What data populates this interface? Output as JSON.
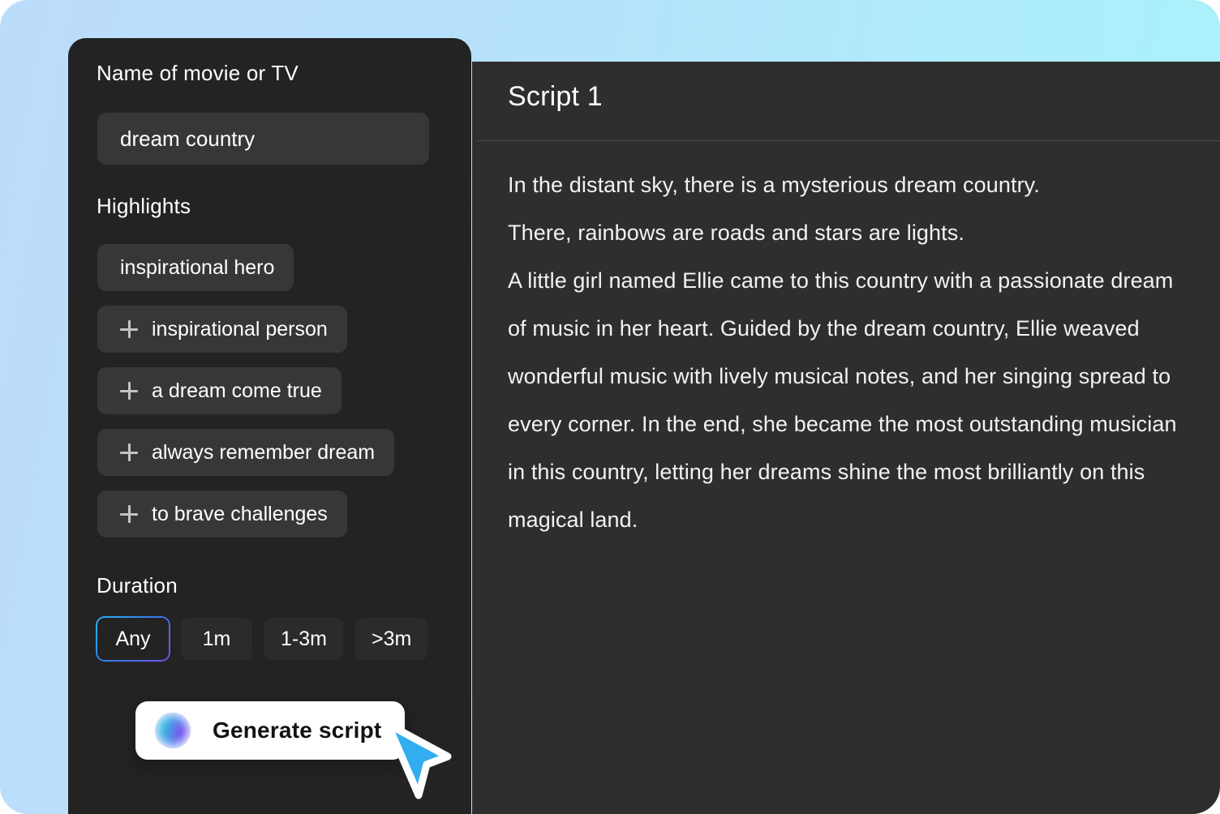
{
  "theme": {
    "bg_gradient_from": "#bcdcfb",
    "bg_gradient_to": "#a9f2fd",
    "left_card_bg": "#232323",
    "right_panel_bg": "#2e2e2e",
    "field_bg": "#373737",
    "accent_blue": "#2f7ef0",
    "accent_purple": "#7b4ff0",
    "cursor_blue": "#32aef0"
  },
  "form": {
    "name_label": "Name of movie or TV",
    "name_value": "dream country",
    "name_placeholder": "Name of movie or TV",
    "highlights_label": "Highlights",
    "highlights": [
      {
        "label": "inspirational hero",
        "selected": true,
        "icon": ""
      },
      {
        "label": "inspirational person",
        "selected": false,
        "icon": "plus-icon"
      },
      {
        "label": "a dream come true",
        "selected": false,
        "icon": "plus-icon"
      },
      {
        "label": "always remember dream",
        "selected": false,
        "icon": "plus-icon"
      },
      {
        "label": "to brave challenges",
        "selected": false,
        "icon": "plus-icon"
      }
    ],
    "duration_label": "Duration",
    "duration_options": [
      {
        "label": "Any",
        "active": true
      },
      {
        "label": "1m",
        "active": false
      },
      {
        "label": "1-3m",
        "active": false
      },
      {
        "label": ">3m",
        "active": false
      }
    ],
    "generate_button": {
      "label": "Generate script",
      "icon": "sparkle-orb-icon"
    }
  },
  "result": {
    "title": "Script 1",
    "paragraphs": [
      "In the distant sky, there is a mysterious dream country.",
      "There, rainbows are roads and stars are lights.",
      "A little girl named Ellie came to this country with a passionate dream of music in her heart. Guided by the dream country, Ellie weaved wonderful music with lively musical notes, and her singing spread to every corner. In the end, she became the most outstanding musician in this country, letting her dreams shine the most brilliantly on this magical land."
    ]
  },
  "pointer": {
    "icon": "cursor-arrow-icon"
  }
}
